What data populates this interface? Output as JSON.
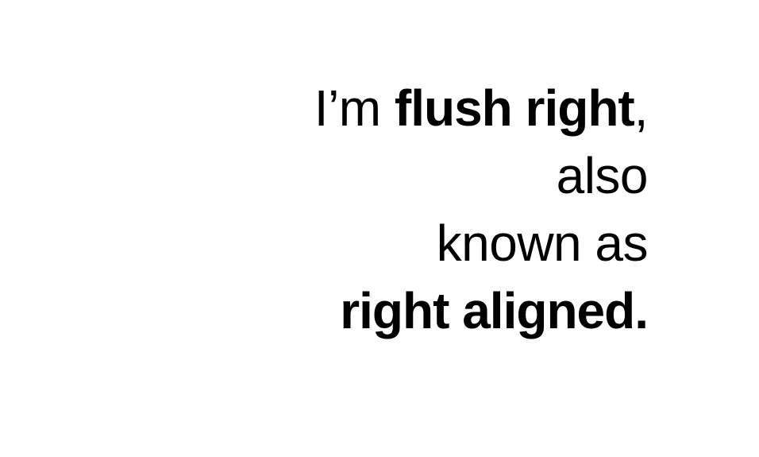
{
  "text": {
    "line1": {
      "prefix": "I’m ",
      "emphasis": "flush right",
      "suffix": ","
    },
    "line2": "also",
    "line3": "known as",
    "line4": "right aligned."
  },
  "colors": {
    "background": "#ffffff",
    "text": "#000000"
  }
}
